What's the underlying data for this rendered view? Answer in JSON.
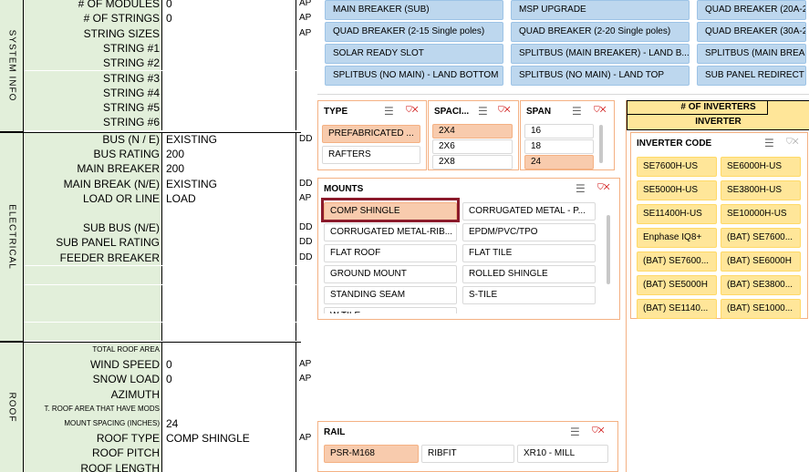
{
  "sections": {
    "system_info": "SYSTEM INFO",
    "electrical": "ELECTRICAL",
    "roof": "ROOF"
  },
  "system_rows": [
    {
      "label": "# OF MODULES",
      "value": "0",
      "ap": "AP"
    },
    {
      "label": "# OF STRINGS",
      "value": "0",
      "ap": "AP"
    },
    {
      "label": "STRING SIZES",
      "value": "",
      "ap": "AP"
    },
    {
      "label": "STRING #1",
      "value": "",
      "ap": ""
    },
    {
      "label": "STRING #2",
      "value": "",
      "ap": ""
    },
    {
      "label": "STRING #3",
      "value": "",
      "ap": ""
    },
    {
      "label": "STRING #4",
      "value": "",
      "ap": ""
    },
    {
      "label": "STRING #5",
      "value": "",
      "ap": ""
    },
    {
      "label": "STRING #6",
      "value": "",
      "ap": ""
    }
  ],
  "electrical_rows": [
    {
      "label": "BUS (N / E)",
      "value": "EXISTING",
      "ap": "DD"
    },
    {
      "label": "BUS RATING",
      "value": "200",
      "ap": ""
    },
    {
      "label": "MAIN BREAKER",
      "value": "200",
      "ap": ""
    },
    {
      "label": "MAIN BREAK (N/E)",
      "value": "EXISTING",
      "ap": "DD"
    },
    {
      "label": "LOAD OR LINE",
      "value": "LOAD",
      "ap": "AP"
    },
    {
      "label": "",
      "value": "",
      "ap": ""
    },
    {
      "label": "SUB BUS (N/E)",
      "value": "",
      "ap": "DD"
    },
    {
      "label": "SUB PANEL RATING",
      "value": "",
      "ap": "DD"
    },
    {
      "label": "FEEDER BREAKER",
      "value": "",
      "ap": "DD"
    }
  ],
  "roof_rows": [
    {
      "label": "TOTAL ROOF AREA",
      "value": "",
      "ap": ""
    },
    {
      "label": "WIND SPEED",
      "value": "0",
      "ap": "AP"
    },
    {
      "label": "SNOW LOAD",
      "value": "0",
      "ap": "AP"
    },
    {
      "label": "AZIMUTH",
      "value": "",
      "ap": ""
    },
    {
      "label": "T. ROOF AREA THAT HAVE MODS",
      "value": "",
      "ap": ""
    },
    {
      "label": "MOUNT SPACING (INCHES)",
      "value": "24",
      "ap": ""
    },
    {
      "label": "ROOF TYPE",
      "value": "COMP SHINGLE",
      "ap": "AP"
    },
    {
      "label": "ROOF PITCH",
      "value": "",
      "ap": ""
    },
    {
      "label": "ROOF LENGTH",
      "value": "",
      "ap": ""
    }
  ],
  "breaker_slicer": {
    "items": [
      "MAIN BREAKER (SUB)",
      "MSP UPGRADE",
      "QUAD BREAKER (20A-2",
      "QUAD BREAKER (2-15 Single poles)",
      "QUAD BREAKER (2-20 Single poles)",
      "QUAD BREAKER (30A-2",
      "SOLAR READY SLOT",
      "SPLITBUS (MAIN BREAKER) - LAND B...",
      "SPLITBUS (MAIN BREAK",
      "SPLITBUS (NO MAIN) - LAND BOTTOM",
      "SPLITBUS (NO MAIN) - LAND TOP",
      "SUB PANEL REDIRECT (L"
    ]
  },
  "type_slicer": {
    "title": "TYPE",
    "items": [
      "PREFABRICATED ...",
      "RAFTERS"
    ],
    "selected": 0
  },
  "spacing_slicer": {
    "title": "SPACI...",
    "items": [
      "2X4",
      "2X6",
      "2X8"
    ],
    "selected": 0
  },
  "span_slicer": {
    "title": "SPAN",
    "items": [
      "16",
      "18",
      "24"
    ],
    "selected": 2
  },
  "mounts_slicer": {
    "title": "MOUNTS",
    "items": [
      "COMP SHINGLE",
      "CORRUGATED METAL - P...",
      "CORRUGATED METAL-RIB...",
      "EPDM/PVC/TPO",
      "FLAT ROOF",
      "FLAT TILE",
      "GROUND MOUNT",
      "ROLLED SHINGLE",
      "STANDING SEAM",
      "S-TILE",
      "W TILE",
      ""
    ],
    "selected": 0
  },
  "rail_slicer": {
    "title": "RAIL",
    "items": [
      "PSR-M168",
      "RIBFIT",
      "XR10 - MILL"
    ],
    "selected": 0
  },
  "inverter": {
    "header1": "# OF INVERTERS",
    "header2": "INVERTER",
    "slicer_title": "INVERTER CODE",
    "items": [
      "SE7600H-US",
      "SE6000H-US",
      "SE5000H-US",
      "SE3800H-US",
      "SE11400H-US",
      "SE10000H-US",
      "Enphase IQ8+",
      "(BAT) SE7600...",
      "(BAT) SE7600...",
      "(BAT) SE6000H",
      "(BAT) SE5000H",
      "(BAT) SE3800...",
      "(BAT) SE1140...",
      "(BAT) SE1000..."
    ]
  },
  "colors": {
    "green": "#e2efda",
    "slicer_selected": "#f8cbad",
    "slicer_border": "#f4b183",
    "blue": "#bdd7ee",
    "yellow": "#ffe699",
    "highlight": "#8b1a2b"
  },
  "icons": {
    "multi_select": "multi-select-icon",
    "clear_filter": "clear-filter-icon"
  }
}
